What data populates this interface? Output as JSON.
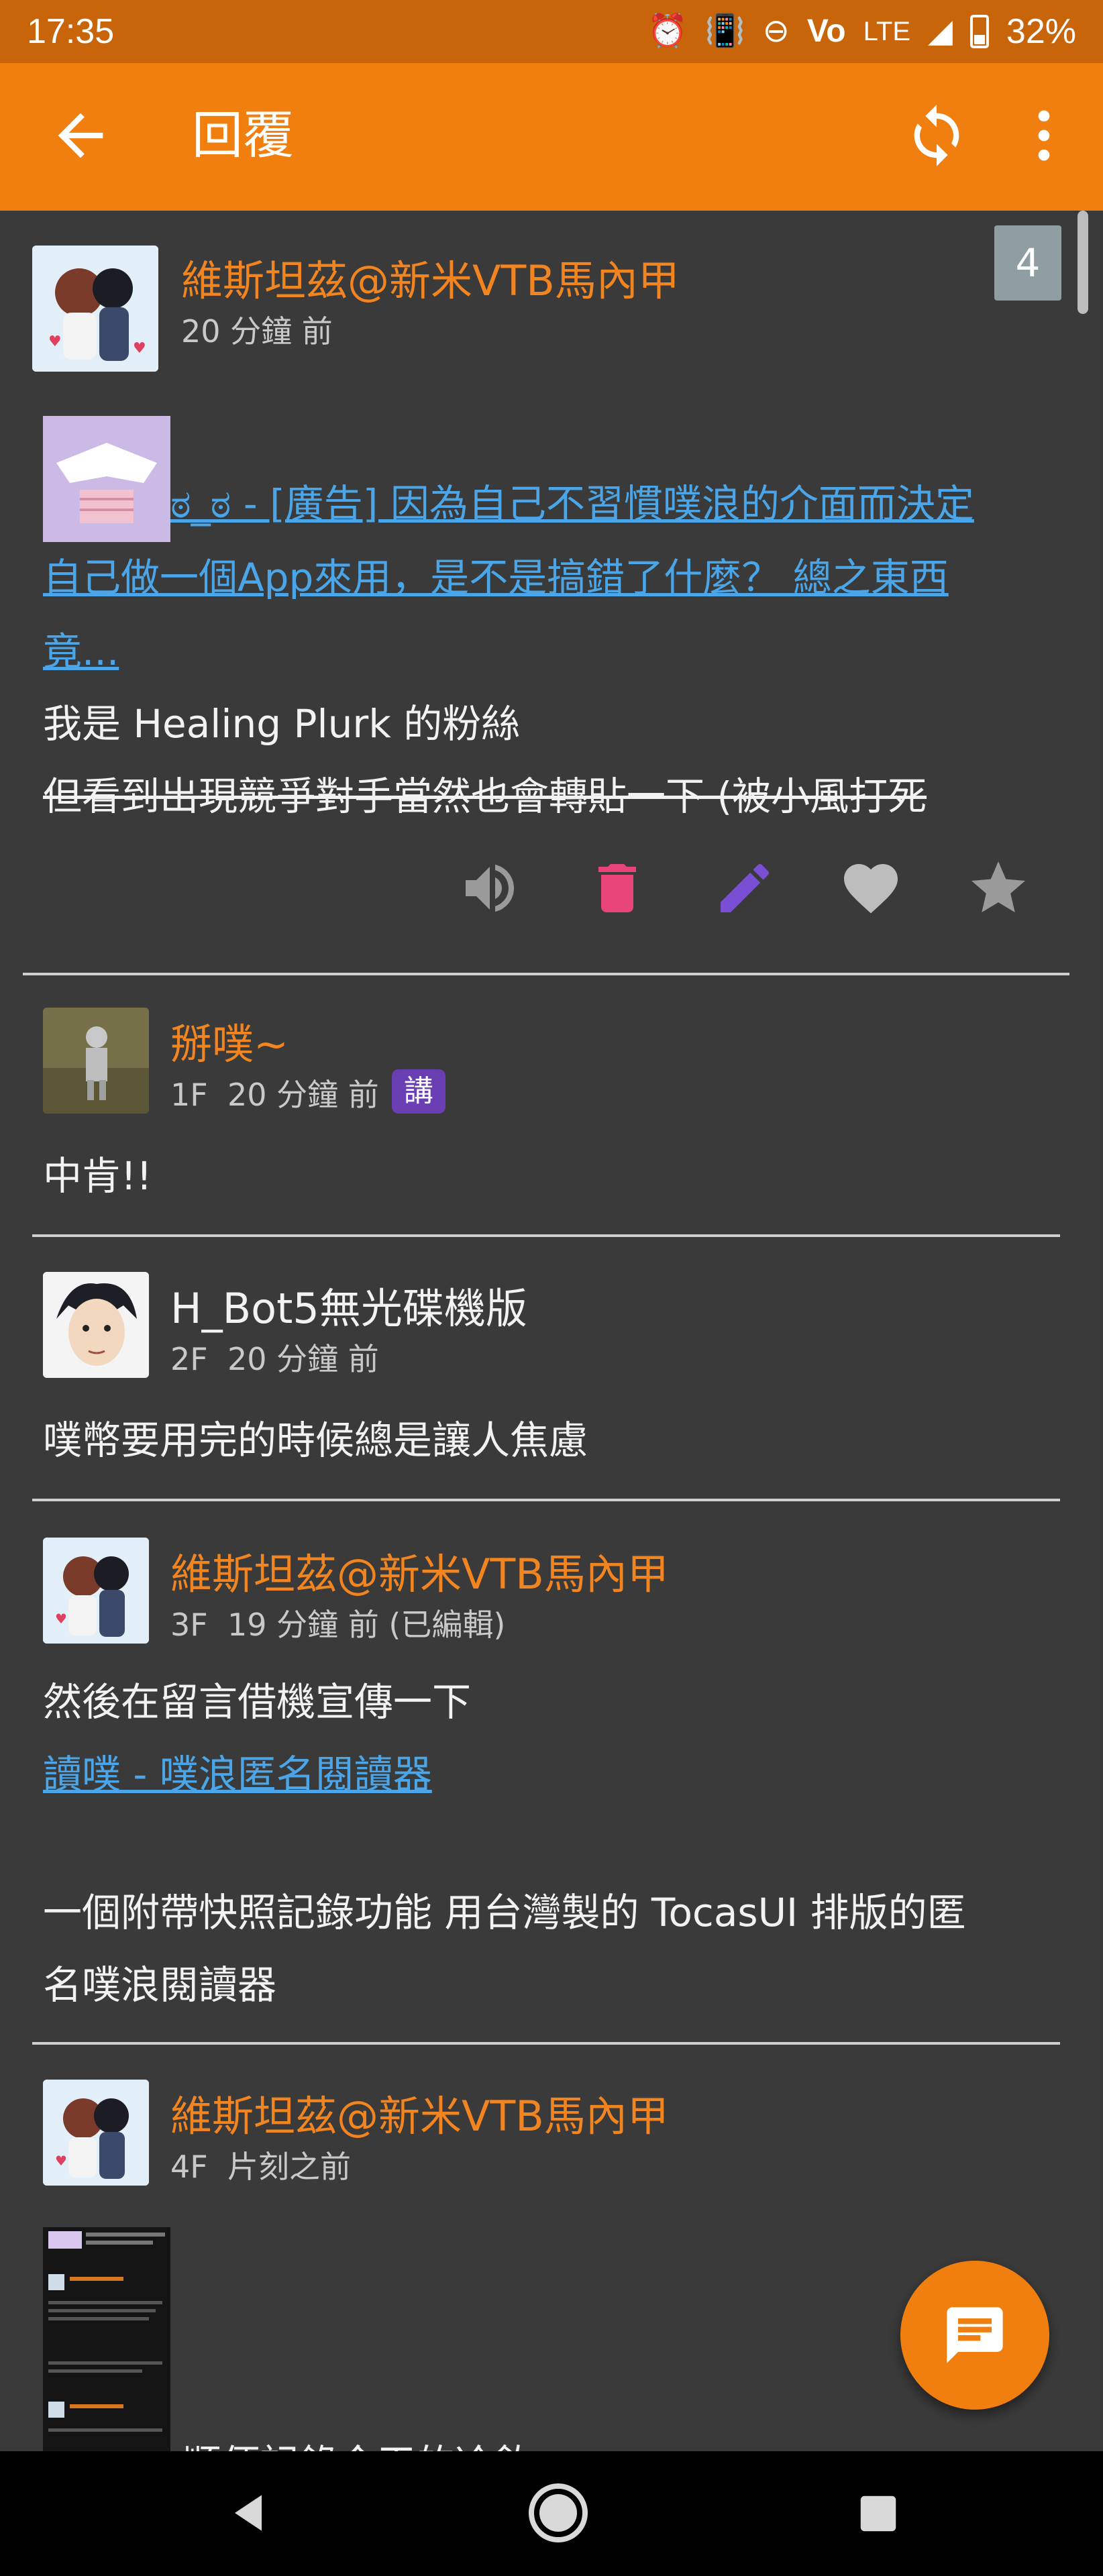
{
  "status_bar": {
    "time": "17:35",
    "network": "LTE",
    "battery": "32%",
    "icons": [
      "alarm-icon",
      "vibrate-icon",
      "dnd-icon",
      "volte-icon",
      "signal-icon",
      "battery-icon"
    ]
  },
  "app_bar": {
    "title": "回覆",
    "icons": [
      "back-arrow-icon",
      "refresh-icon",
      "more-vert-icon"
    ]
  },
  "colors": {
    "accent": "#f07f10",
    "status_bar": "#c8650a",
    "background": "#3a3a3a",
    "name_orange": "#f28520",
    "link_blue": "#4aa6e8",
    "delete_pink": "#e8447a",
    "edit_purple": "#7a4fd6",
    "speaker_badge": "#6a3fb3"
  },
  "main_post": {
    "author": "維斯坦茲@新米VTB馬內甲",
    "time": "20 分鐘 前",
    "response_count": "4",
    "link_line1": "ಠ_ಠ - [廣告] 因為自己不習慣噗浪的介面而決定",
    "link_line2": "自己做一個App來用，是不是搞錯了什麼？ 總之東西",
    "link_line3": "竟...",
    "body_line1": "我是 Healing Plurk 的粉絲",
    "body_line2": "但看到出現競爭對手當然也會轉貼一下 (被小風打死",
    "actions": [
      "volume-icon",
      "delete-icon",
      "edit-icon",
      "like-heart-icon",
      "favorite-star-icon"
    ]
  },
  "responses": [
    {
      "author": "掰噗~",
      "floor": "1F",
      "time": "20 分鐘 前",
      "badge": "講",
      "lines": [
        "中肯!!"
      ]
    },
    {
      "author": "H_Bot5無光碟機版",
      "floor": "2F",
      "time": "20 分鐘 前",
      "lines": [
        "噗幣要用完的時候總是讓人焦慮"
      ]
    },
    {
      "author": "維斯坦茲@新米VTB馬內甲",
      "floor": "3F",
      "time": "19 分鐘 前 (已編輯)",
      "lines": [
        "然後在留言借機宣傳一下"
      ],
      "link": "讀噗 - 噗浪匿名閱讀器",
      "lines_after": [
        "一個附帶快照記錄功能 用台灣製的 TocasUI 排版的匿",
        "名噗浪閱讀器"
      ]
    },
    {
      "author": "維斯坦茲@新米VTB馬內甲",
      "floor": "4F",
      "time": "片刻之前",
      "partial_text": "順便記錄今天的冷飲"
    }
  ],
  "fab": {
    "icon": "reply-message-icon"
  },
  "nav_bar": {
    "icons": [
      "nav-back-icon",
      "nav-home-icon",
      "nav-recents-icon"
    ]
  }
}
